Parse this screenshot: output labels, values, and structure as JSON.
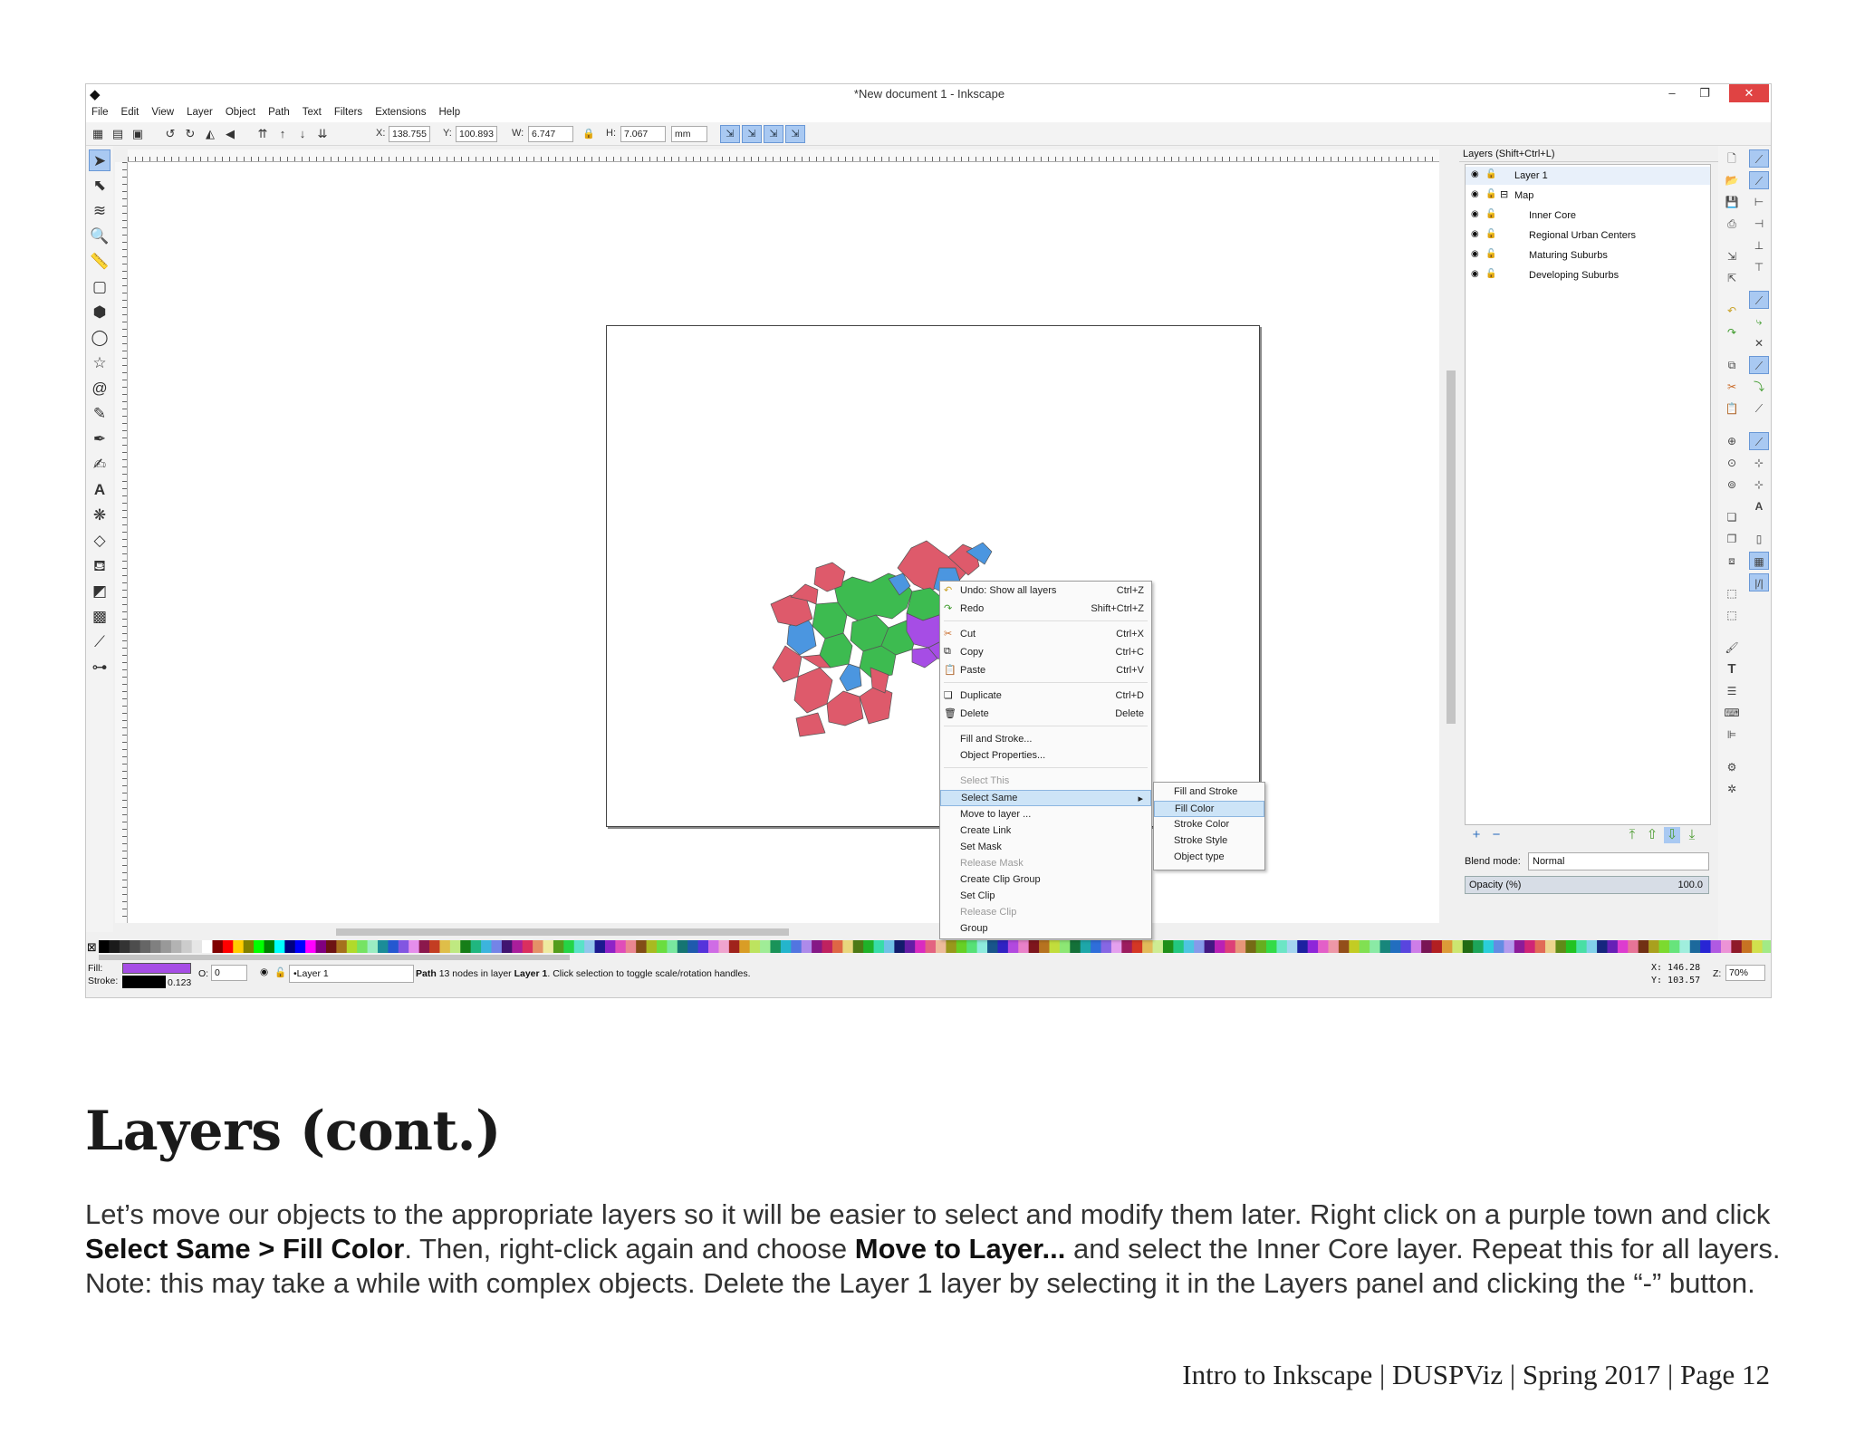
{
  "window": {
    "title": "*New document 1 - Inkscape",
    "menu": [
      "File",
      "Edit",
      "View",
      "Layer",
      "Object",
      "Path",
      "Text",
      "Filters",
      "Extensions",
      "Help"
    ]
  },
  "toolbar": {
    "x_label": "X:",
    "x_value": "138.755",
    "y_label": "Y:",
    "y_value": "100.893",
    "w_label": "W:",
    "w_value": "6.747",
    "h_label": "H:",
    "h_value": "7.067",
    "unit": "mm"
  },
  "context_menu": {
    "items": [
      {
        "label": "Undo: Show all layers",
        "shortcut": "Ctrl+Z"
      },
      {
        "label": "Redo",
        "shortcut": "Shift+Ctrl+Z"
      },
      {
        "label": "Cut",
        "shortcut": "Ctrl+X"
      },
      {
        "label": "Copy",
        "shortcut": "Ctrl+C"
      },
      {
        "label": "Paste",
        "shortcut": "Ctrl+V"
      },
      {
        "label": "Duplicate",
        "shortcut": "Ctrl+D"
      },
      {
        "label": "Delete",
        "shortcut": "Delete"
      },
      {
        "label": "Fill and Stroke..."
      },
      {
        "label": "Object Properties..."
      },
      {
        "label": "Select This"
      },
      {
        "label": "Select Same"
      },
      {
        "label": "Move to layer ..."
      },
      {
        "label": "Create Link"
      },
      {
        "label": "Set Mask"
      },
      {
        "label": "Release Mask"
      },
      {
        "label": "Create Clip Group"
      },
      {
        "label": "Set Clip"
      },
      {
        "label": "Release Clip"
      },
      {
        "label": "Group"
      }
    ],
    "submenu": [
      "Fill and Stroke",
      "Fill Color",
      "Stroke Color",
      "Stroke Style",
      "Object type"
    ]
  },
  "layers_panel": {
    "title": "Layers (Shift+Ctrl+L)",
    "layers": [
      "Layer 1",
      "Map",
      "Inner Core",
      "Regional Urban Centers",
      "Maturing Suburbs",
      "Developing Suburbs"
    ],
    "blend_label": "Blend mode:",
    "blend_value": "Normal",
    "opacity_label": "Opacity (%)",
    "opacity_value": "100.0"
  },
  "statusbar": {
    "fill_label": "Fill:",
    "stroke_label": "Stroke:",
    "stroke_width": "0.123",
    "opacity_label": "O:",
    "opacity_value": "0",
    "layer": "•Layer 1",
    "message_prefix": "Path",
    "message_mid": "13 nodes in layer",
    "message_layer": "Layer 1",
    "message_suffix": ". Click selection to toggle scale/rotation handles.",
    "x_coord": "X: 146.28",
    "y_coord": "Y: 103.57",
    "zoom_label": "Z:",
    "zoom": "70%"
  },
  "slide": {
    "heading": "Layers (cont.)",
    "p1": "Let’s move our objects to the appropriate layers so it will be easier to select and modify them later. Right click on a purple town and click ",
    "b1": "Select Same > Fill Color",
    "p2": ". Then, right-click again and choose ",
    "b2": "Move to Layer...",
    "p3": " and select the Inner Core layer. Repeat this for all layers. Note: this may take a while with complex objects. Delete the Layer 1 layer by selecting it in the Layers panel and clicking the “-” button.",
    "footer": "Intro to Inkscape | DUSPViz | Spring 2017 | Page 12"
  },
  "colors": {
    "map_red": "#de5a6b",
    "map_green": "#3dbb50",
    "map_blue": "#4b96e0",
    "map_purple": "#a64de5",
    "highlight": "#cde4f7"
  }
}
